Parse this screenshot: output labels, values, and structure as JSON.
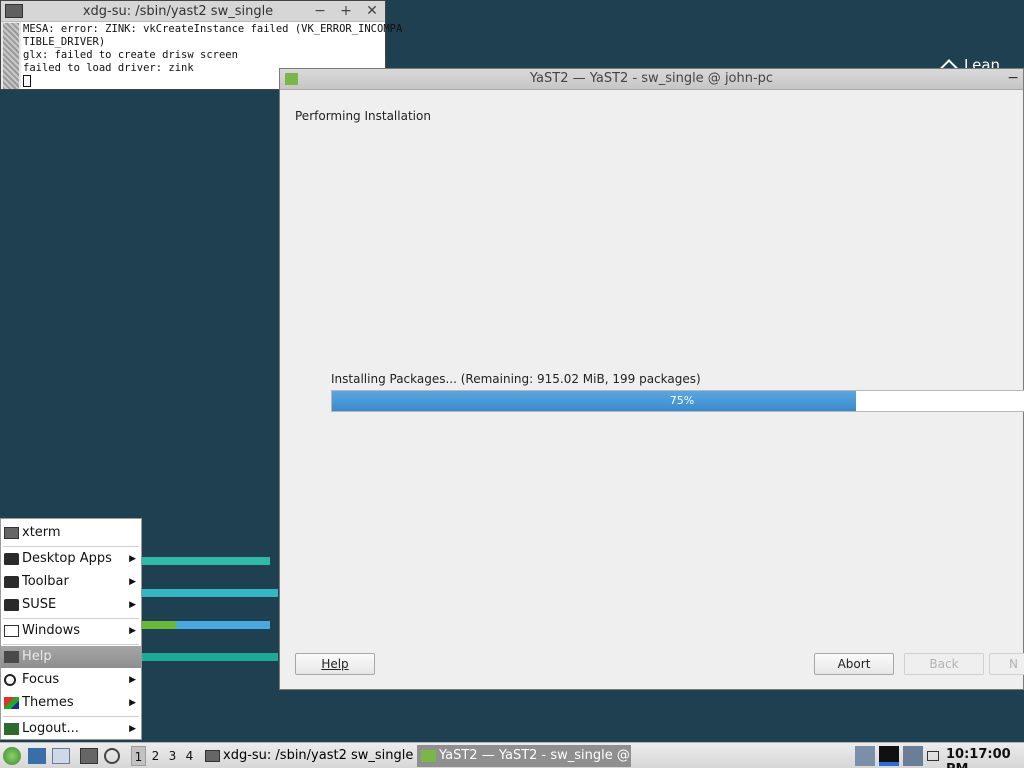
{
  "desktop": {
    "corner_text": "Lean"
  },
  "xterm": {
    "title": "xdg-su: /sbin/yast2 sw_single",
    "controls": {
      "minimize": "−",
      "maximize": "+",
      "close": "✕"
    },
    "lines": [
      "MESA: error: ZINK: vkCreateInstance failed (VK_ERROR_INCOMPA",
      "TIBLE_DRIVER)",
      "glx: failed to create drisw screen",
      "failed to load driver: zink"
    ]
  },
  "yast": {
    "title": "YaST2 — YaST2 - sw_single @ john-pc",
    "min_control": "−",
    "heading": "Performing Installation",
    "progress_label": "Installing Packages... (Remaining: 915.02 MiB, 199 packages)",
    "progress_percent": 75,
    "progress_text": "75%",
    "buttons": {
      "help": "Help",
      "abort": "Abort",
      "back": "Back",
      "next": "N"
    }
  },
  "menu": {
    "items": [
      {
        "label": "xterm",
        "icon": "terminal-icon"
      },
      {
        "label": "Desktop Apps",
        "icon": "folder-icon",
        "submenu": true
      },
      {
        "label": "Toolbar",
        "icon": "folder-icon",
        "submenu": true
      },
      {
        "label": "SUSE",
        "icon": "folder-icon",
        "submenu": true
      },
      {
        "label": "Windows",
        "icon": "windows-icon",
        "submenu": true
      },
      {
        "label": "Help",
        "icon": "help-icon",
        "active": true
      },
      {
        "label": "Focus",
        "icon": "focus-icon",
        "submenu": true
      },
      {
        "label": "Themes",
        "icon": "themes-icon",
        "submenu": true
      },
      {
        "label": "Logout...",
        "icon": "logout-icon",
        "submenu": true
      }
    ],
    "arrow": "▶"
  },
  "taskbar": {
    "desktops": [
      "1",
      "2",
      "3",
      "4"
    ],
    "current_desktop": "1",
    "tasks": [
      {
        "label": "xdg-su: /sbin/yast2 sw_single",
        "active": false
      },
      {
        "label": "YaST2 — YaST2 - sw_single @...",
        "active": true
      }
    ],
    "clock": "10:17:00 PM"
  },
  "colors": {
    "desktop_bg": "#1f4050",
    "progress_fill": "#3a8bcf",
    "accent_teal": "#30b8a8"
  }
}
